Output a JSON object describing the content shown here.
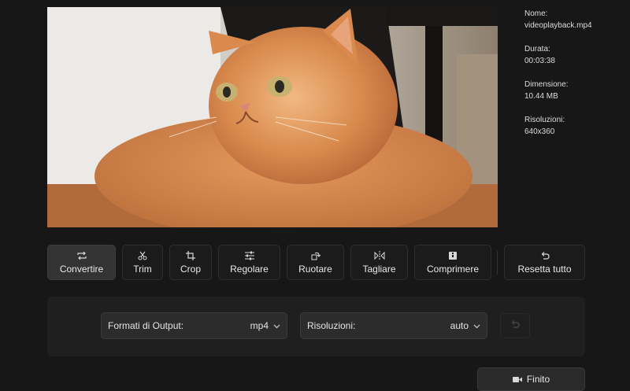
{
  "file_info": {
    "name_label": "Nome:",
    "name_value": "videoplayback.mp4",
    "duration_label": "Durata:",
    "duration_value": "00:03:38",
    "size_label": "Dimensione:",
    "size_value": "10.44 MB",
    "resolution_label": "Risoluzioni:",
    "resolution_value": "640x360"
  },
  "toolbar": {
    "convert": {
      "label": "Convertire",
      "icon": "repeat-icon"
    },
    "trim": {
      "label": "Trim",
      "icon": "scissors-icon"
    },
    "crop": {
      "label": "Crop",
      "icon": "crop-icon"
    },
    "adjust": {
      "label": "Regolare",
      "icon": "sliders-icon"
    },
    "rotate": {
      "label": "Ruotare",
      "icon": "rotate-icon"
    },
    "cut": {
      "label": "Tagliare",
      "icon": "split-icon"
    },
    "compress": {
      "label": "Comprimere",
      "icon": "compress-icon"
    },
    "reset": {
      "label": "Resetta tutto",
      "icon": "undo-icon"
    }
  },
  "output": {
    "format_label": "Formati di Output:",
    "format_value": "mp4",
    "resolution_label": "Risoluzioni:",
    "resolution_value": "auto"
  },
  "finish_label": "Finito",
  "colors": {
    "background": "#171717",
    "panel": "#1f1f1f",
    "active_tool": "#333333"
  }
}
